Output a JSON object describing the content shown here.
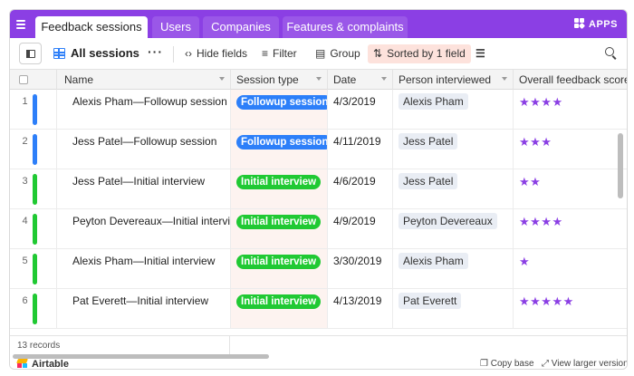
{
  "topbar": {
    "tabs": [
      {
        "label": "Feedback sessions",
        "active": true
      },
      {
        "label": "Users",
        "active": false
      },
      {
        "label": "Companies",
        "active": false
      },
      {
        "label": "Features & complaints",
        "active": false
      }
    ],
    "apps_label": "APPS"
  },
  "toolbar": {
    "view_name": "All sessions",
    "more": "···",
    "hide_fields": "Hide fields",
    "filter": "Filter",
    "group": "Group",
    "sorted": "Sorted by 1 field"
  },
  "columns": {
    "name": "Name",
    "session_type": "Session type",
    "date": "Date",
    "person": "Person interviewed",
    "score": "Overall feedback score"
  },
  "rows": [
    {
      "num": "1",
      "color": "#2d7ff9",
      "name": "Alexis Pham—Followup session",
      "session": "Followup session",
      "session_color": "#2d7ff9",
      "date": "4/3/2019",
      "person": "Alexis Pham",
      "stars": "★★★★",
      "rating": 4
    },
    {
      "num": "2",
      "color": "#2d7ff9",
      "name": "Jess Patel—Followup session",
      "session": "Followup session",
      "session_color": "#2d7ff9",
      "date": "4/11/2019",
      "person": "Jess Patel",
      "stars": "★★★",
      "rating": 3
    },
    {
      "num": "3",
      "color": "#20c933",
      "name": "Jess Patel—Initial interview",
      "session": "Initial interview",
      "session_color": "#20c933",
      "date": "4/6/2019",
      "person": "Jess Patel",
      "stars": "★★",
      "rating": 2
    },
    {
      "num": "4",
      "color": "#20c933",
      "name": "Peyton Devereaux—Initial interview",
      "session": "Initial interview",
      "session_color": "#20c933",
      "date": "4/9/2019",
      "person": "Peyton Devereaux",
      "stars": "★★★★",
      "rating": 4
    },
    {
      "num": "5",
      "color": "#20c933",
      "name": "Alexis Pham—Initial interview",
      "session": "Initial interview",
      "session_color": "#20c933",
      "date": "3/30/2019",
      "person": "Alexis Pham",
      "stars": "★",
      "rating": 1
    },
    {
      "num": "6",
      "color": "#20c933",
      "name": "Pat Everett—Initial interview",
      "session": "Initial interview",
      "session_color": "#20c933",
      "date": "4/13/2019",
      "person": "Pat Everett",
      "stars": "★★★★★",
      "rating": 5
    }
  ],
  "footer": {
    "records": "13 records",
    "brand": "Airtable",
    "copy_base": "Copy base",
    "view_larger": "View larger version"
  }
}
